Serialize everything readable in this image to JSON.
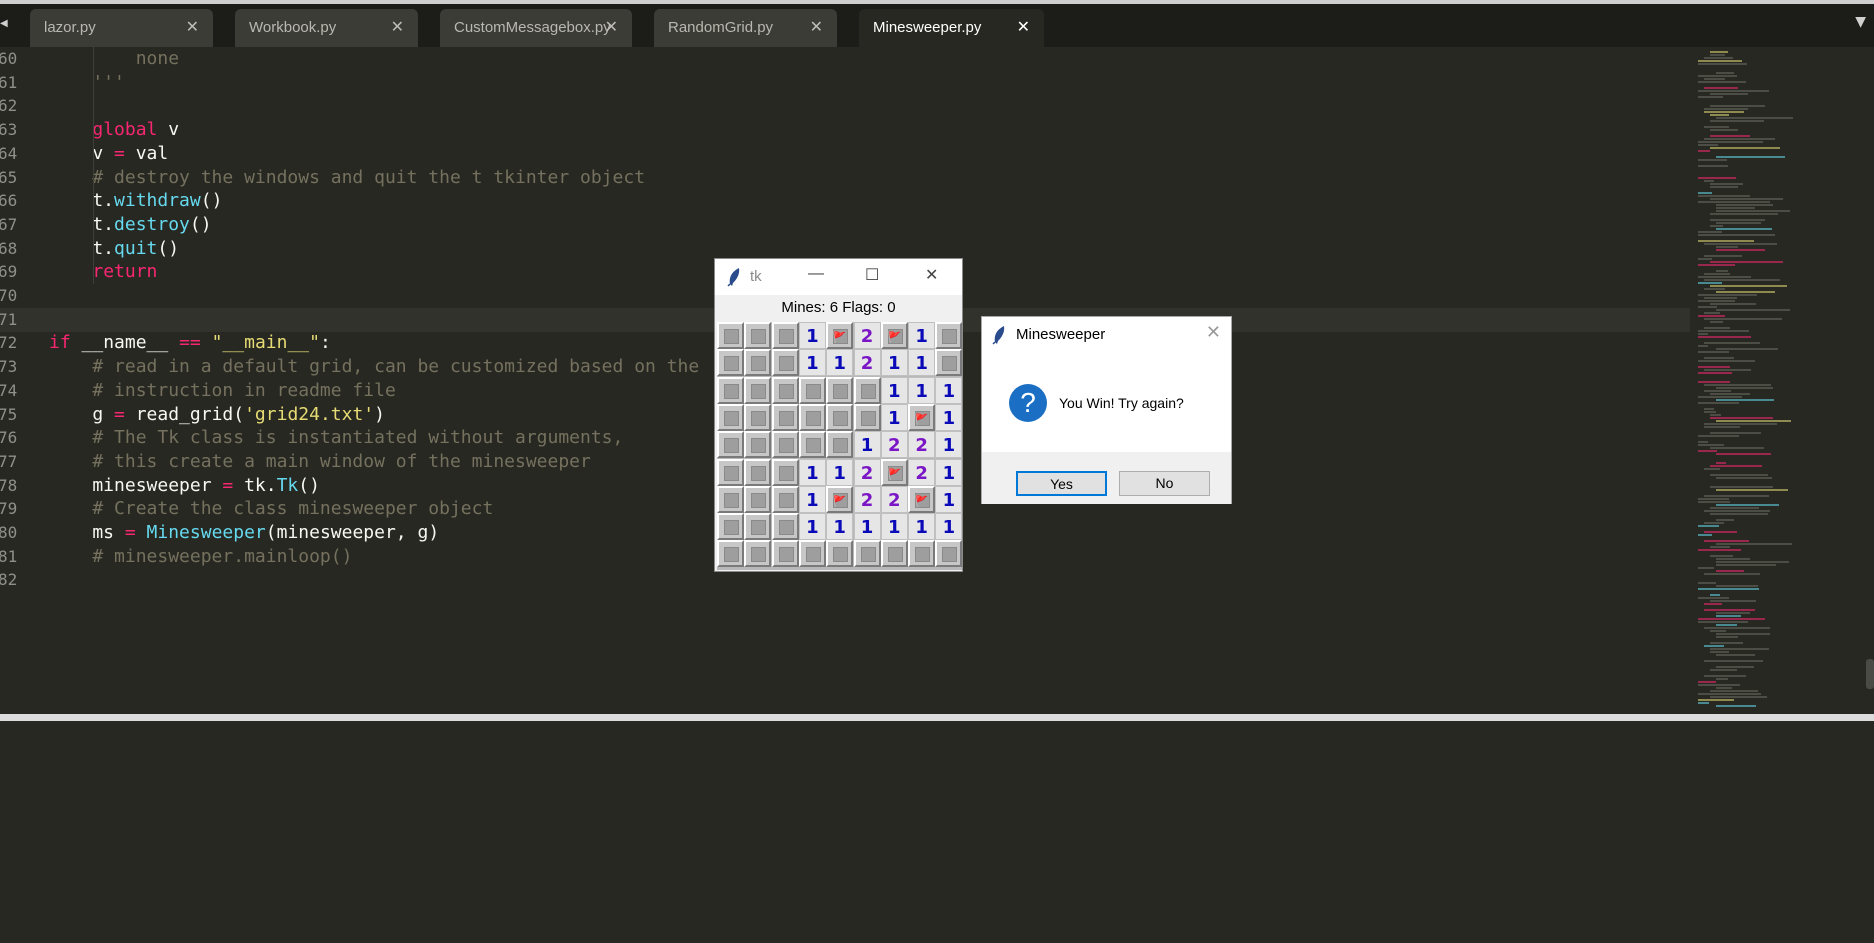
{
  "tabs": [
    {
      "label": "lazor.py",
      "active": false
    },
    {
      "label": "Workbook.py",
      "active": false
    },
    {
      "label": "CustomMessagebox.py",
      "active": false
    },
    {
      "label": "RandomGrid.py",
      "active": false
    },
    {
      "label": "Minesweeper.py",
      "active": true
    }
  ],
  "editor": {
    "lines": [
      {
        "num": "60",
        "tokens": [
          {
            "t": "        none",
            "c": "cm"
          }
        ]
      },
      {
        "num": "61",
        "tokens": [
          {
            "t": "    '''",
            "c": "cm"
          }
        ]
      },
      {
        "num": "62",
        "tokens": []
      },
      {
        "num": "63",
        "tokens": [
          {
            "t": "    ",
            "c": ""
          },
          {
            "t": "global",
            "c": "kw"
          },
          {
            "t": " v",
            "c": ""
          }
        ]
      },
      {
        "num": "64",
        "tokens": [
          {
            "t": "    v ",
            "c": ""
          },
          {
            "t": "=",
            "c": "kw"
          },
          {
            "t": " val",
            "c": ""
          }
        ]
      },
      {
        "num": "65",
        "tokens": [
          {
            "t": "    # destroy the windows and quit the t tkinter object",
            "c": "cm"
          }
        ]
      },
      {
        "num": "66",
        "tokens": [
          {
            "t": "    t.",
            "c": ""
          },
          {
            "t": "withdraw",
            "c": "fn"
          },
          {
            "t": "()",
            "c": ""
          }
        ]
      },
      {
        "num": "67",
        "tokens": [
          {
            "t": "    t.",
            "c": ""
          },
          {
            "t": "destroy",
            "c": "fn"
          },
          {
            "t": "()",
            "c": ""
          }
        ]
      },
      {
        "num": "68",
        "tokens": [
          {
            "t": "    t.",
            "c": ""
          },
          {
            "t": "quit",
            "c": "fn"
          },
          {
            "t": "()",
            "c": ""
          }
        ]
      },
      {
        "num": "69",
        "tokens": [
          {
            "t": "    ",
            "c": ""
          },
          {
            "t": "return",
            "c": "kw"
          }
        ]
      },
      {
        "num": "70",
        "tokens": []
      },
      {
        "num": "71",
        "tokens": [],
        "current": true
      },
      {
        "num": "72",
        "tokens": [
          {
            "t": "if",
            "c": "kw"
          },
          {
            "t": " __name__ ",
            "c": ""
          },
          {
            "t": "==",
            "c": "kw"
          },
          {
            "t": " ",
            "c": ""
          },
          {
            "t": "\"__main__\"",
            "c": "str"
          },
          {
            "t": ":",
            "c": ""
          }
        ]
      },
      {
        "num": "73",
        "tokens": [
          {
            "t": "    # read in a default grid, can be customized based on the",
            "c": "cm"
          }
        ]
      },
      {
        "num": "74",
        "tokens": [
          {
            "t": "    # instruction in readme file",
            "c": "cm"
          }
        ]
      },
      {
        "num": "75",
        "tokens": [
          {
            "t": "    g ",
            "c": ""
          },
          {
            "t": "=",
            "c": "kw"
          },
          {
            "t": " read_grid(",
            "c": ""
          },
          {
            "t": "'grid24.txt'",
            "c": "str"
          },
          {
            "t": ")",
            "c": ""
          }
        ]
      },
      {
        "num": "76",
        "tokens": [
          {
            "t": "    # The Tk class is instantiated without arguments,",
            "c": "cm"
          }
        ]
      },
      {
        "num": "77",
        "tokens": [
          {
            "t": "    # this create a main window of the minesweeper",
            "c": "cm"
          }
        ]
      },
      {
        "num": "78",
        "tokens": [
          {
            "t": "    minesweeper ",
            "c": ""
          },
          {
            "t": "=",
            "c": "kw"
          },
          {
            "t": " tk.",
            "c": ""
          },
          {
            "t": "Tk",
            "c": "fn"
          },
          {
            "t": "()",
            "c": ""
          }
        ]
      },
      {
        "num": "79",
        "tokens": [
          {
            "t": "    # Create the class minesweeper object",
            "c": "cm"
          }
        ]
      },
      {
        "num": "80",
        "tokens": [
          {
            "t": "    ms ",
            "c": ""
          },
          {
            "t": "=",
            "c": "kw"
          },
          {
            "t": " ",
            "c": ""
          },
          {
            "t": "Minesweeper",
            "c": "fn"
          },
          {
            "t": "(minesweeper, g)",
            "c": ""
          }
        ]
      },
      {
        "num": "81",
        "tokens": [
          {
            "t": "    # minesweeper.mainloop()",
            "c": "cm"
          }
        ]
      },
      {
        "num": "82",
        "tokens": []
      }
    ]
  },
  "tk_window": {
    "title": "tk",
    "status": "Mines: 6  Flags: 0",
    "grid": [
      [
        "u",
        "u",
        "u",
        "1",
        "f",
        "2",
        "f",
        "1",
        "u"
      ],
      [
        "u",
        "u",
        "u",
        "1",
        "1",
        "2",
        "1",
        "1",
        "u"
      ],
      [
        "u",
        "u",
        "u",
        "u",
        "u",
        "u",
        "1",
        "1",
        "1"
      ],
      [
        "u",
        "u",
        "u",
        "u",
        "u",
        "u",
        "1",
        "f",
        "1"
      ],
      [
        "u",
        "u",
        "u",
        "u",
        "u",
        "1",
        "2",
        "2",
        "1"
      ],
      [
        "u",
        "u",
        "u",
        "1",
        "1",
        "2",
        "f",
        "2",
        "1"
      ],
      [
        "u",
        "u",
        "u",
        "1",
        "f",
        "2",
        "2",
        "f",
        "1"
      ],
      [
        "u",
        "u",
        "u",
        "1",
        "1",
        "1",
        "1",
        "1",
        "1"
      ],
      [
        "u",
        "u",
        "u",
        "u",
        "u",
        "u",
        "u",
        "u",
        "u"
      ]
    ]
  },
  "dialog": {
    "title": "Minesweeper",
    "message": "You Win! Try again?",
    "yes_label": "Yes",
    "no_label": "No",
    "icon": "question-icon"
  },
  "colors": {
    "editor_bg": "#272822",
    "keyword": "#f92672",
    "comment": "#75715e",
    "string": "#e6db74",
    "function": "#66d9ef"
  }
}
